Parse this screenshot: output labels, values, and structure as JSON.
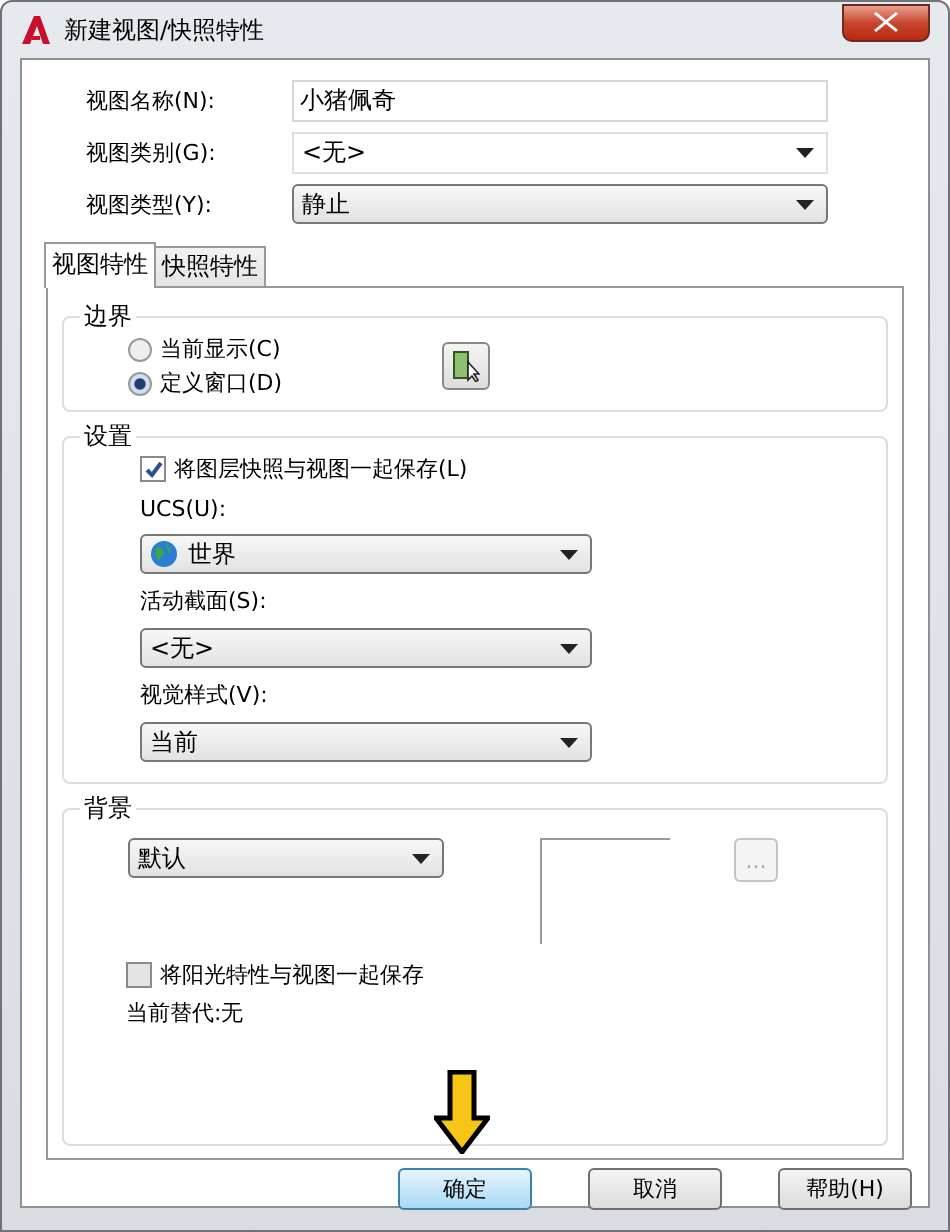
{
  "window": {
    "title": "新建视图/快照特性"
  },
  "fields": [
    {
      "label": "视图名称(N):",
      "value": "小猪佩奇",
      "kind": "text"
    },
    {
      "label": "视图类别(G):",
      "value": "<无>",
      "kind": "combo"
    },
    {
      "label": "视图类型(Y):",
      "value": "静止",
      "kind": "dropdown"
    }
  ],
  "tabs": [
    {
      "label": "视图特性",
      "selected": true
    },
    {
      "label": "快照特性",
      "selected": false
    }
  ],
  "boundary": {
    "title": "边界",
    "options": [
      {
        "label": "当前显示(C)",
        "selected": false
      },
      {
        "label": "定义窗口(D)",
        "selected": true
      }
    ]
  },
  "settings": {
    "title": "设置",
    "checkbox": {
      "label": "将图层快照与视图一起保存(L)",
      "checked": true
    },
    "dropdowns": [
      {
        "label": "UCS(U):",
        "value": "世界",
        "kind": "globe"
      },
      {
        "label": "活动截面(S):",
        "value": "<无>",
        "kind": "plain"
      },
      {
        "label": "视觉样式(V):",
        "value": "当前",
        "kind": "plain"
      }
    ]
  },
  "background": {
    "title": "背景",
    "value": "默认",
    "browse": {
      "label": "...",
      "disabled": true
    },
    "checkbox": {
      "label": "将阳光特性与视图一起保存",
      "checked": false
    },
    "override": "当前替代:无"
  },
  "buttons": [
    {
      "label": "确定",
      "default": true
    },
    {
      "label": "取消",
      "default": false
    },
    {
      "label": "帮助(H)",
      "default": false
    }
  ]
}
